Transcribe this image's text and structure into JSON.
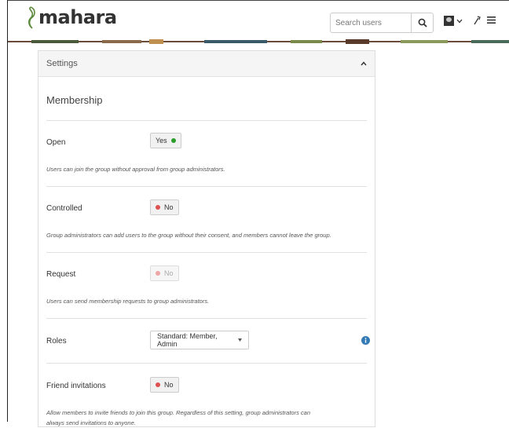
{
  "header": {
    "logo_text": "mahara",
    "search": {
      "placeholder": "Search users"
    }
  },
  "settings": {
    "title": "Settings",
    "membership": {
      "legend": "Membership",
      "open": {
        "label": "Open",
        "value": "Yes",
        "description": "Users can join the group without approval from group administrators."
      },
      "controlled": {
        "label": "Controlled",
        "value": "No",
        "description": "Group administrators can add users to the group without their consent, and members cannot leave the group."
      },
      "request": {
        "label": "Request",
        "value": "No",
        "description": "Users can send membership requests to group administrators."
      },
      "roles": {
        "label": "Roles",
        "selected": "Standard: Member, Admin"
      },
      "friend_invitations": {
        "label": "Friend invitations",
        "value": "No",
        "description": "Allow members to invite friends to join this group. Regardless of this setting, group administrators can always send invitations to anyone."
      }
    }
  },
  "colors": {
    "on": "#2a9d2a",
    "off": "#e05050",
    "info": "#337ab7"
  }
}
